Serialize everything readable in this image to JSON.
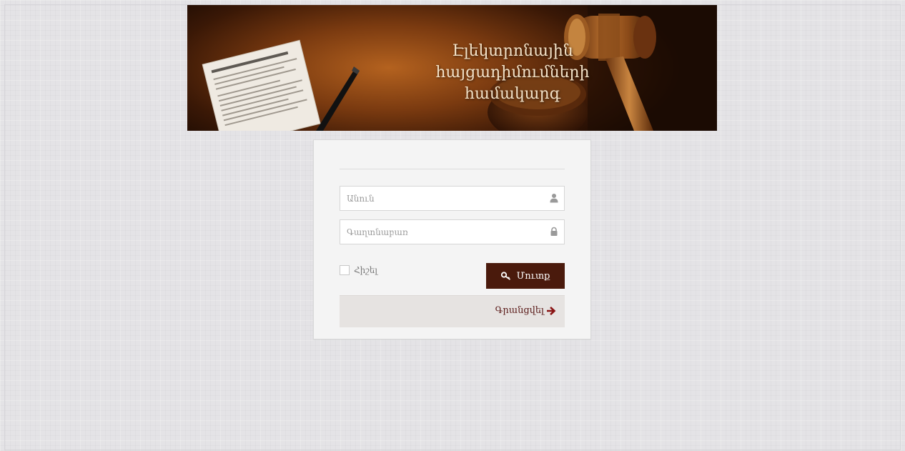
{
  "banner": {
    "title_line1": "Էլեկտրոնային",
    "title_line2": "հայցադիմումների",
    "title_line3": "համակարգ"
  },
  "login_form": {
    "username_placeholder": "Անուն",
    "password_placeholder": "Գաղտնաբառ",
    "remember_label": "Հիշել",
    "login_button_label": "Մուտք",
    "register_link_label": "Գրանցվել"
  },
  "icons": {
    "username": "user-icon",
    "password": "lock-icon",
    "login": "key-icon",
    "register": "arrow-right-icon"
  },
  "colors": {
    "page_background": "#e4e3e6",
    "button_background": "#4a1a0c",
    "register_bar_background": "#e6e3e1",
    "register_link_color": "#5a1a18",
    "banner_text": "#f3e2c8"
  }
}
